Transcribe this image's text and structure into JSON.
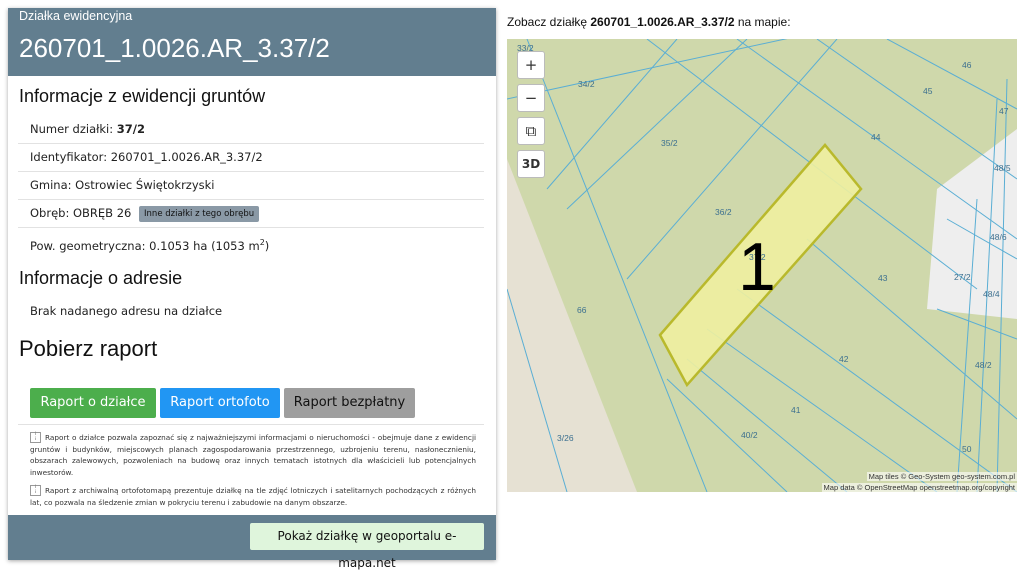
{
  "header": {
    "subtitle": "Działka ewidencyjna",
    "title": "260701_1.0026.AR_3.37/2"
  },
  "section_ewidencja": {
    "heading": "Informacje z ewidencji gruntów",
    "numer_label": "Numer działki: ",
    "numer_value": "37/2",
    "identyfikator": "Identyfikator: 260701_1.0026.AR_3.37/2",
    "gmina": "Gmina: Ostrowiec Świętokrzyski",
    "obreb": "Obręb: OBRĘB 26",
    "obreb_button": "Inne działki z tego obrębu",
    "pow_prefix": "Pow. geometryczna: 0.1053 ha (1053 m",
    "pow_sup": "2",
    "pow_suffix": ")"
  },
  "section_adres": {
    "heading": "Informacje o adresie",
    "text": "Brak nadanego adresu na działce"
  },
  "section_raport": {
    "heading": "Pobierz raport",
    "buttons": [
      {
        "label": "Raport o działce",
        "color": "#4cae4c"
      },
      {
        "label": "Raport ortofoto",
        "color": "#2196f3"
      },
      {
        "label": "Raport bezpłatny",
        "color": "#9e9e9e"
      }
    ],
    "note1": "Raport o działce pozwala zapoznać się z najważniejszymi informacjami o nieruchomości - obejmuje dane z ewidencji gruntów i budynków, miejscowych planach zagospodarowania przestrzennego, uzbrojeniu terenu, nasłonecznieniu, obszarach zalewowych, pozwoleniach na budowę oraz innych tematach istotnych dla właścicieli lub potencjalnych inwestorów.",
    "note2": "Raport z archiwalną ortofotomapą prezentuje działkę na tle zdjęć lotniczych i satelitarnych pochodzących z różnych lat, co pozwala na śledzenie zmian w pokryciu terenu i zabudowie na danym obszarze."
  },
  "footer": {
    "geoportal_button": "Pokaż działkę w geoportalu e-mapa.net"
  },
  "map": {
    "caption_prefix": "Zobacz działkę ",
    "caption_id": "260701_1.0026.AR_3.37/2",
    "caption_suffix": " na mapie:",
    "controls": {
      "zoom_in": "+",
      "zoom_out": "−",
      "layers": "⧉",
      "three_d": "3D"
    },
    "marker": "1",
    "parcel_labels": [
      "33/2",
      "34/2",
      "35/2",
      "36/2",
      "37/2",
      "44",
      "45",
      "46",
      "47",
      "48/5",
      "48/6",
      "27/2",
      "48/4",
      "43",
      "42",
      "48/2",
      "41",
      "40/2",
      "3/26",
      "50",
      "66"
    ],
    "attribution_tiles": "Map tiles © Geo-System geo-system.com.pl",
    "attribution_data": "Map data © OpenStreetMap openstreetmap.org/copyright",
    "colors": {
      "land": "#cfd8ab",
      "parcel_fill": "#eef0a0",
      "parcel_stroke": "#b9b92c",
      "boundary": "#5aaed4"
    }
  }
}
